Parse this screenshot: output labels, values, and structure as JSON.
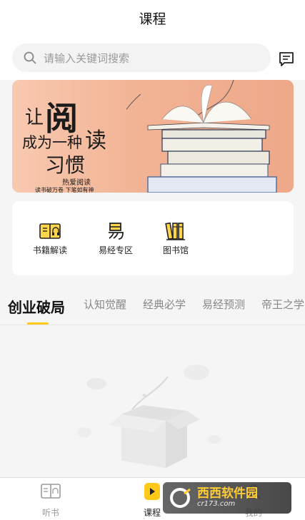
{
  "header": {
    "title": "课程"
  },
  "search": {
    "placeholder": "请输入关键词搜索",
    "icon": "search-icon"
  },
  "banner": {
    "lines": [
      "让",
      "阅",
      "成为一种",
      "读",
      "习惯",
      "热爱阅读",
      "读书破万卷  下笔如有神"
    ],
    "colors": {
      "background": "#f2b394"
    }
  },
  "categories": [
    {
      "label": "书籍解读",
      "icon": "book-headphones-icon"
    },
    {
      "label": "易经专区",
      "icon": "yi-glyph-icon"
    },
    {
      "label": "图书馆",
      "icon": "bookshelf-icon"
    }
  ],
  "tabs": [
    {
      "label": "创业破局",
      "active": true
    },
    {
      "label": "认知觉醒"
    },
    {
      "label": "经典必学"
    },
    {
      "label": "易经预测"
    },
    {
      "label": "帝王之学"
    }
  ],
  "tabbar": [
    {
      "label": "听书",
      "icon": "audiobook-icon"
    },
    {
      "label": "课程",
      "icon": "play-icon",
      "active": true
    },
    {
      "label": "我的",
      "icon": "user-icon"
    }
  ],
  "watermark": {
    "main": "西西软件园",
    "sub": "cr173.com"
  },
  "colors": {
    "accent": "#ffc919",
    "page_bg": "#f5f5f5"
  }
}
